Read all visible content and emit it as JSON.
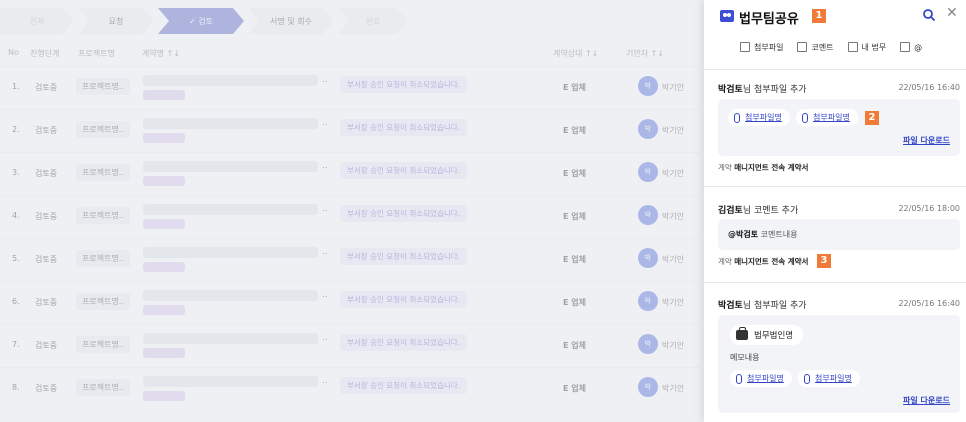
{
  "background": {
    "steps": [
      "전체",
      "요청",
      "✓ 검토",
      "서명 및 회수",
      "완료"
    ],
    "headers": {
      "no": "No",
      "stage": "진행단계",
      "project": "프로젝트명",
      "contract": "계약명 ↑↓",
      "status": "계약상대 ↑↓",
      "requester": "기안자 ↑↓"
    },
    "rows": [
      {
        "no": "1.",
        "stage": "검토중",
        "project": "프로젝트명..",
        "dots": "..",
        "request": "부서장 승인 요청이 취소되었습니다.",
        "entity": "E 업체",
        "avatar": "박",
        "name": "박기안"
      },
      {
        "no": "2.",
        "stage": "검토중",
        "project": "프로젝트명..",
        "dots": "..",
        "request": "부서장 승인 요청이 취소되었습니다.",
        "entity": "E 업체",
        "avatar": "박",
        "name": "박기안"
      },
      {
        "no": "3.",
        "stage": "검토중",
        "project": "프로젝트명..",
        "dots": "..",
        "request": "부서장 승인 요청이 취소되었습니다.",
        "entity": "E 업체",
        "avatar": "박",
        "name": "박기안"
      },
      {
        "no": "4.",
        "stage": "검토중",
        "project": "프로젝트명..",
        "dots": "..",
        "request": "부서장 승인 요청이 취소되었습니다.",
        "entity": "E 업체",
        "avatar": "박",
        "name": "박기안"
      },
      {
        "no": "5.",
        "stage": "검토중",
        "project": "프로젝트명..",
        "dots": "..",
        "request": "부서장 승인 요청이 취소되었습니다.",
        "entity": "E 업체",
        "avatar": "박",
        "name": "박기안"
      },
      {
        "no": "6.",
        "stage": "검토중",
        "project": "프로젝트명..",
        "dots": "..",
        "request": "부서장 승인 요청이 취소되었습니다.",
        "entity": "E 업체",
        "avatar": "박",
        "name": "박기안"
      },
      {
        "no": "7.",
        "stage": "검토중",
        "project": "프로젝트명..",
        "dots": "..",
        "request": "부서장 승인 요청이 취소되었습니다.",
        "entity": "E 업체",
        "avatar": "박",
        "name": "박기안"
      },
      {
        "no": "8.",
        "stage": "검토중",
        "project": "프로젝트명..",
        "dots": "..",
        "request": "부서장 승인 요청이 취소되었습니다.",
        "entity": "E 업체",
        "avatar": "박",
        "name": "박기안"
      }
    ]
  },
  "panel": {
    "title": "법무팀공유",
    "markers": [
      "1",
      "2",
      "3"
    ],
    "filters": [
      "첨부파일",
      "코멘트",
      "내 법무",
      "@"
    ],
    "entries": [
      {
        "author": "박검토",
        "action": "님 첨부파일 추가",
        "date": "22/05/16 16:40",
        "files": [
          "첨부파일명",
          "첨부파일명"
        ],
        "download": "파일 다운로드",
        "meta_label": "계약",
        "meta_value": "매니지먼트 전속 계약서"
      },
      {
        "author": "김검토",
        "action": "님 코멘트 추가",
        "date": "22/05/16 18:00",
        "mention": "@박검토",
        "comment": " 코멘트내용",
        "meta_label": "계약",
        "meta_value": "매니지먼트 전속 계약서"
      },
      {
        "author": "박검토",
        "action": "님 첨부파일 추가",
        "date": "22/05/16 16:40",
        "firm": "법무법인명",
        "memo": "메모내용",
        "files": [
          "첨부파일명",
          "첨부파일명"
        ],
        "download": "파일 다운로드"
      }
    ]
  },
  "colors": {
    "accent": "#3446c8",
    "marker": "#f27a38",
    "step_active": "#5a63c9",
    "badge": "#ece9fb"
  }
}
